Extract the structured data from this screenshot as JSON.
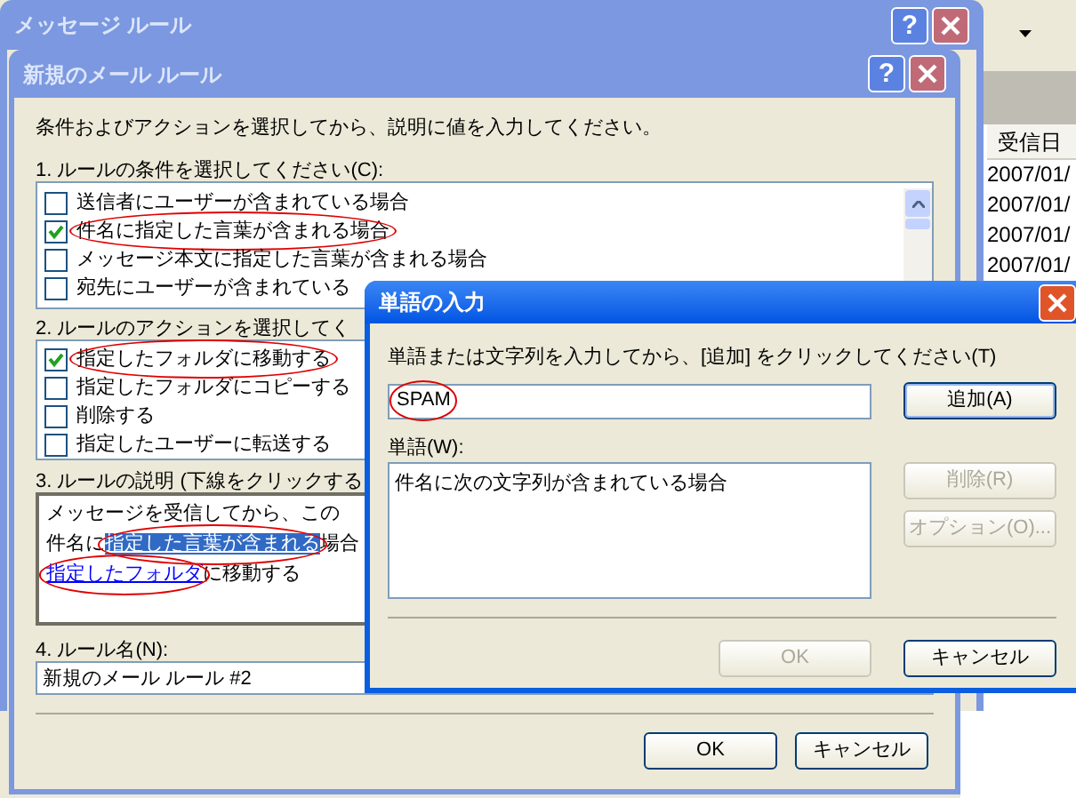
{
  "background_window": {
    "column_header": "受信日",
    "rows": [
      "2007/01/",
      "2007/01/",
      "2007/01/",
      "2007/01/"
    ]
  },
  "message_rules_dialog": {
    "title": "メッセージ ルール",
    "help_glyph": "?"
  },
  "new_rule_dialog": {
    "title": "新規のメール ルール",
    "help_glyph": "?",
    "instruction": "条件およびアクションを選択してから、説明に値を入力してください。",
    "conditions_label": "1. ルールの条件を選択してください(C):",
    "conditions": [
      {
        "label": "送信者にユーザーが含まれている場合",
        "checked": false,
        "circled": false
      },
      {
        "label": "件名に指定した言葉が含まれる場合",
        "checked": true,
        "circled": true
      },
      {
        "label": "メッセージ本文に指定した言葉が含まれる場合",
        "checked": false,
        "circled": false
      },
      {
        "label": "宛先にユーザーが含まれている",
        "checked": false,
        "circled": false
      }
    ],
    "actions_label": "2. ルールのアクションを選択してく",
    "actions": [
      {
        "label": "指定したフォルダに移動する",
        "checked": true,
        "circled": true
      },
      {
        "label": "指定したフォルダにコピーする",
        "checked": false,
        "circled": false
      },
      {
        "label": "削除する",
        "checked": false,
        "circled": false
      },
      {
        "label": "指定したユーザーに転送する",
        "checked": false,
        "circled": false
      }
    ],
    "description_label": "3. ルールの説明 (下線をクリックする",
    "description": [
      [
        {
          "text": "メッセージを受信してから、この",
          "kind": "plain"
        }
      ],
      [
        {
          "text": "件名に",
          "kind": "plain"
        },
        {
          "text": "指定した言葉が含まれる",
          "kind": "link",
          "selected": true,
          "circled": true
        },
        {
          "text": "場合",
          "kind": "plain"
        }
      ],
      [
        {
          "text": "指定したフォルダ",
          "kind": "link",
          "selected": false,
          "circled": true
        },
        {
          "text": "に移動する",
          "kind": "plain"
        }
      ]
    ],
    "rule_name_label": "4. ルール名(N):",
    "rule_name": "新規のメール ルール #2",
    "buttons": [
      {
        "label": "OK",
        "disabled": false
      },
      {
        "label": "キャンセル",
        "disabled": false
      }
    ]
  },
  "word_dialog": {
    "title": "単語の入力",
    "prompt": "単語または文字列を入力してから、[追加] をクリックしてください(T)",
    "input": {
      "value": "SPAM",
      "circled": true
    },
    "add_button": "追加(A)",
    "words_label": "単語(W):",
    "words": [
      "件名に次の文字列が含まれている場合"
    ],
    "side_buttons": [
      {
        "label": "削除(R)",
        "disabled": true
      },
      {
        "label": "オプション(O)...",
        "disabled": true
      }
    ],
    "buttons": [
      {
        "label": "OK",
        "disabled": true
      },
      {
        "label": "キャンセル",
        "disabled": false
      }
    ]
  }
}
